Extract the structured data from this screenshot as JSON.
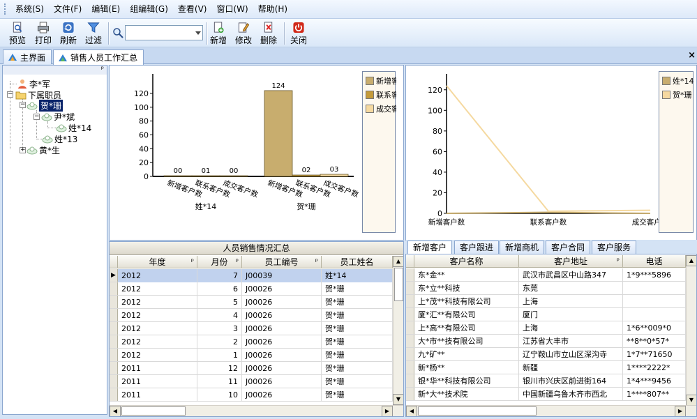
{
  "menu": [
    "系统(S)",
    "文件(F)",
    "编辑(E)",
    "组编辑(G)",
    "查看(V)",
    "窗口(W)",
    "帮助(H)"
  ],
  "toolbar": {
    "preview": "预览",
    "print": "打印",
    "refresh": "刷新",
    "filter": "过滤",
    "search_value": "",
    "add": "新增",
    "edit": "修改",
    "delete": "删除",
    "close": "关闭"
  },
  "tabs": {
    "home": "主界面",
    "report": "销售人员工作汇总",
    "close": "×"
  },
  "tree": {
    "pin": "ᵖ",
    "root": "李*军",
    "group": "下属职员",
    "n1": "贺*珊",
    "n1a": "尹*斌",
    "n1a1": "姓*14",
    "n1b": "姓*13",
    "n2": "黄*生"
  },
  "colors": {
    "series1": "#c8ad6e",
    "series2": "#c49b3a",
    "series3": "#f5d9a0",
    "line1": "#c8ad6e",
    "line2": "#f5d9a0",
    "selected": "#0a246a"
  },
  "chart_data": [
    {
      "type": "bar",
      "groups": [
        "姓*14",
        "贺*珊"
      ],
      "categories": [
        "新增客户数",
        "联系客户数",
        "成交客户数"
      ],
      "series": [
        {
          "name": "新增客",
          "values": [
            0,
            124
          ]
        },
        {
          "name": "联系客",
          "values": [
            1,
            2
          ]
        },
        {
          "name": "成交客",
          "values": [
            0,
            3
          ]
        }
      ],
      "value_labels": [
        [
          "00",
          "01",
          "00"
        ],
        [
          "124",
          "02",
          "03"
        ]
      ],
      "yticks": [
        0,
        20,
        40,
        60,
        80,
        100,
        120
      ],
      "ylim": [
        0,
        130
      ],
      "legend": "right"
    },
    {
      "type": "line",
      "categories": [
        "新增客户数",
        "联系客户数",
        "成交客户数"
      ],
      "series": [
        {
          "name": "姓*14",
          "values": [
            0,
            1,
            0
          ]
        },
        {
          "name": "贺*珊",
          "values": [
            124,
            2,
            3
          ]
        }
      ],
      "yticks": [
        0,
        20,
        40,
        60,
        80,
        100,
        120
      ],
      "ylim": [
        0,
        130
      ],
      "legend": "right"
    }
  ],
  "summary_grid": {
    "title": "人员销售情况汇总",
    "columns": [
      "年度",
      "月份",
      "员工编号",
      "员工姓名"
    ],
    "rows": [
      [
        "2012",
        "7",
        "J00039",
        "姓*14"
      ],
      [
        "2012",
        "6",
        "J00026",
        "贺*珊"
      ],
      [
        "2012",
        "5",
        "J00026",
        "贺*珊"
      ],
      [
        "2012",
        "4",
        "J00026",
        "贺*珊"
      ],
      [
        "2012",
        "3",
        "J00026",
        "贺*珊"
      ],
      [
        "2012",
        "2",
        "J00026",
        "贺*珊"
      ],
      [
        "2012",
        "1",
        "J00026",
        "贺*珊"
      ],
      [
        "2011",
        "12",
        "J00026",
        "贺*珊"
      ],
      [
        "2011",
        "11",
        "J00026",
        "贺*珊"
      ],
      [
        "2011",
        "10",
        "J00026",
        "贺*珊"
      ]
    ]
  },
  "customer_tabs": [
    "新增客户",
    "客户跟进",
    "新增商机",
    "客户合同",
    "客户服务"
  ],
  "customer_grid": {
    "columns": [
      "客户名称",
      "客户地址",
      "电话"
    ],
    "rows": [
      [
        "东*金**",
        "武汉市武昌区中山路347",
        "1*9***5896"
      ],
      [
        "东*立**科技",
        "东莞",
        ""
      ],
      [
        "上*茂**科技有限公司",
        "上海",
        ""
      ],
      [
        "厦*汇**有限公司",
        "厦门",
        ""
      ],
      [
        "上*高**有限公司",
        "上海",
        "1*6**009*0"
      ],
      [
        "大*市**技有限公司",
        "江苏省大丰市",
        "**8**0*57*"
      ],
      [
        "九*矿**",
        "辽宁鞍山市立山区深沟寺",
        "1*7**71650"
      ],
      [
        "新*杨**",
        "新疆",
        "1****2222*"
      ],
      [
        "银*华**科技有限公司",
        "银川市兴庆区前进街164",
        "1*4***9456"
      ],
      [
        "新*大**技术院",
        "中国新疆乌鲁木齐市西北",
        "1****807**"
      ]
    ]
  }
}
